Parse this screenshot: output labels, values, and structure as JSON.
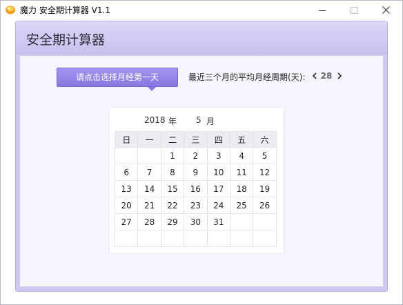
{
  "window": {
    "title": "魔力 安全期计算器 V1.1",
    "icon": "app-logo-icon"
  },
  "header": {
    "title": "安全期计算器"
  },
  "controls": {
    "select_button_label": "请点击选择月经第一天",
    "cycle_label": "最近三个月的平均月经周期(天):",
    "cycle_value": "28",
    "prev_icon": "chevron-left-icon",
    "next_icon": "chevron-right-icon"
  },
  "calendar": {
    "year": "2018",
    "year_unit": "年",
    "month": "5",
    "month_unit": "月",
    "weekdays": [
      "日",
      "一",
      "二",
      "三",
      "四",
      "五",
      "六"
    ],
    "weeks": [
      [
        "",
        "",
        "1",
        "2",
        "3",
        "4",
        "5"
      ],
      [
        "6",
        "7",
        "8",
        "9",
        "10",
        "11",
        "12"
      ],
      [
        "13",
        "14",
        "15",
        "16",
        "17",
        "18",
        "19"
      ],
      [
        "20",
        "21",
        "22",
        "23",
        "24",
        "25",
        "26"
      ],
      [
        "27",
        "28",
        "29",
        "30",
        "31",
        "",
        ""
      ],
      [
        "",
        "",
        "",
        "",
        "",
        "",
        ""
      ]
    ]
  },
  "colors": {
    "accent": "#8a76e0",
    "frame": "#cfc8ef",
    "panel": "#f6f4fd"
  }
}
